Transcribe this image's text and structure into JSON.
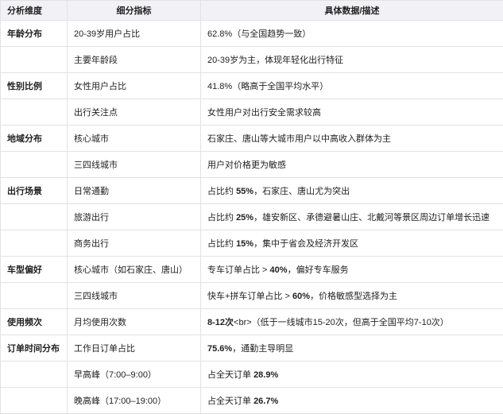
{
  "headers": [
    "分析维度",
    "细分指标",
    "具体数据/描述"
  ],
  "rows": [
    {
      "dim": "年龄分布",
      "metric": "20-39岁用户占比",
      "desc": [
        {
          "t": "62.8%（与全国趋势一致）"
        }
      ]
    },
    {
      "dim": "",
      "metric": "主要年龄段",
      "desc": [
        {
          "t": "20-39岁为主，体现年轻化出行特征"
        }
      ]
    },
    {
      "dim": "性别比例",
      "metric": "女性用户占比",
      "desc": [
        {
          "t": "41.8%（略高于全国平均水平）"
        }
      ]
    },
    {
      "dim": "",
      "metric": "出行关注点",
      "desc": [
        {
          "t": "女性用户对出行安全需求较高"
        }
      ]
    },
    {
      "dim": "地域分布",
      "metric": "核心城市",
      "desc": [
        {
          "t": "石家庄、唐山等大城市用户以中高收入群体为主"
        }
      ]
    },
    {
      "dim": "",
      "metric": "三四线城市",
      "desc": [
        {
          "t": "用户对价格更为敏感"
        }
      ]
    },
    {
      "dim": "出行场景",
      "metric": "日常通勤",
      "desc": [
        {
          "t": "占比约 "
        },
        {
          "t": "55%",
          "b": true
        },
        {
          "t": "，石家庄、唐山尤为突出"
        }
      ]
    },
    {
      "dim": "",
      "metric": "旅游出行",
      "desc": [
        {
          "t": "占比约 "
        },
        {
          "t": "25%",
          "b": true
        },
        {
          "t": "，雄安新区、承德避暑山庄、北戴河等景区周边订单增长迅速"
        }
      ]
    },
    {
      "dim": "",
      "metric": "商务出行",
      "desc": [
        {
          "t": "占比约 "
        },
        {
          "t": "15%",
          "b": true
        },
        {
          "t": "，集中于省会及经济开发区"
        }
      ]
    },
    {
      "dim": "车型偏好",
      "metric": "核心城市（如石家庄、唐山）",
      "desc": [
        {
          "t": "专车订单占比 > "
        },
        {
          "t": "40%",
          "b": true
        },
        {
          "t": "，偏好专车服务"
        }
      ]
    },
    {
      "dim": "",
      "metric": "三四线城市",
      "desc": [
        {
          "t": "快车+拼车订单占比 > "
        },
        {
          "t": "60%",
          "b": true
        },
        {
          "t": "，价格敏感型选择为主"
        }
      ]
    },
    {
      "dim": "使用频次",
      "metric": "月均使用次数",
      "desc": [
        {
          "t": "8-12次",
          "b": true
        },
        {
          "t": "<br>（低于一线城市15-20次，但高于全国平均7-10次）"
        }
      ]
    },
    {
      "dim": "订单时间分布",
      "metric": "工作日订单占比",
      "desc": [
        {
          "t": "75.6%",
          "b": true
        },
        {
          "t": "，通勤主导明显"
        }
      ]
    },
    {
      "dim": "",
      "metric": "早高峰（7:00–9:00）",
      "desc": [
        {
          "t": "占全天订单 "
        },
        {
          "t": "28.9%",
          "b": true
        }
      ]
    },
    {
      "dim": "",
      "metric": "晚高峰（17:00–19:00）",
      "desc": [
        {
          "t": "占全天订单 "
        },
        {
          "t": "26.7%",
          "b": true
        }
      ]
    }
  ]
}
